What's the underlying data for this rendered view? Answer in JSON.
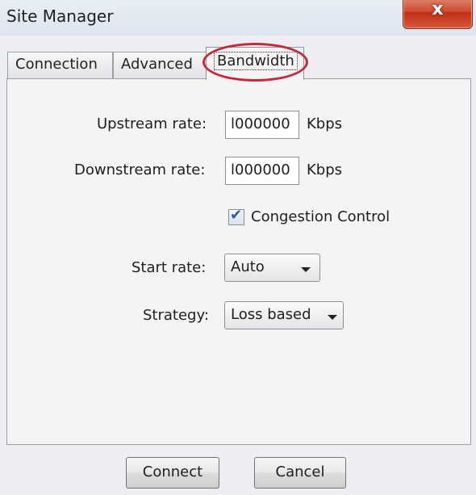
{
  "window": {
    "title": "Site Manager",
    "close_glyph": "x"
  },
  "tabs": [
    {
      "label": "Connection",
      "active": false
    },
    {
      "label": "Advanced",
      "active": false
    },
    {
      "label": "Bandwidth",
      "active": true
    }
  ],
  "bandwidth": {
    "upstream": {
      "label": "Upstream rate:",
      "value": "l000000",
      "unit": "Kbps"
    },
    "downstream": {
      "label": "Downstream rate:",
      "value": "l000000",
      "unit": "Kbps"
    },
    "congestion_control": {
      "label": "Congestion Control",
      "checked": true,
      "check_glyph": "✔"
    },
    "start_rate": {
      "label": "Start rate:",
      "selected": "Auto"
    },
    "strategy": {
      "label": "Strategy:",
      "selected": "Loss based"
    }
  },
  "buttons": {
    "connect": "Connect",
    "cancel": "Cancel"
  },
  "colors": {
    "highlight_ring": "#c8273a",
    "close_button": "#c12e15"
  }
}
